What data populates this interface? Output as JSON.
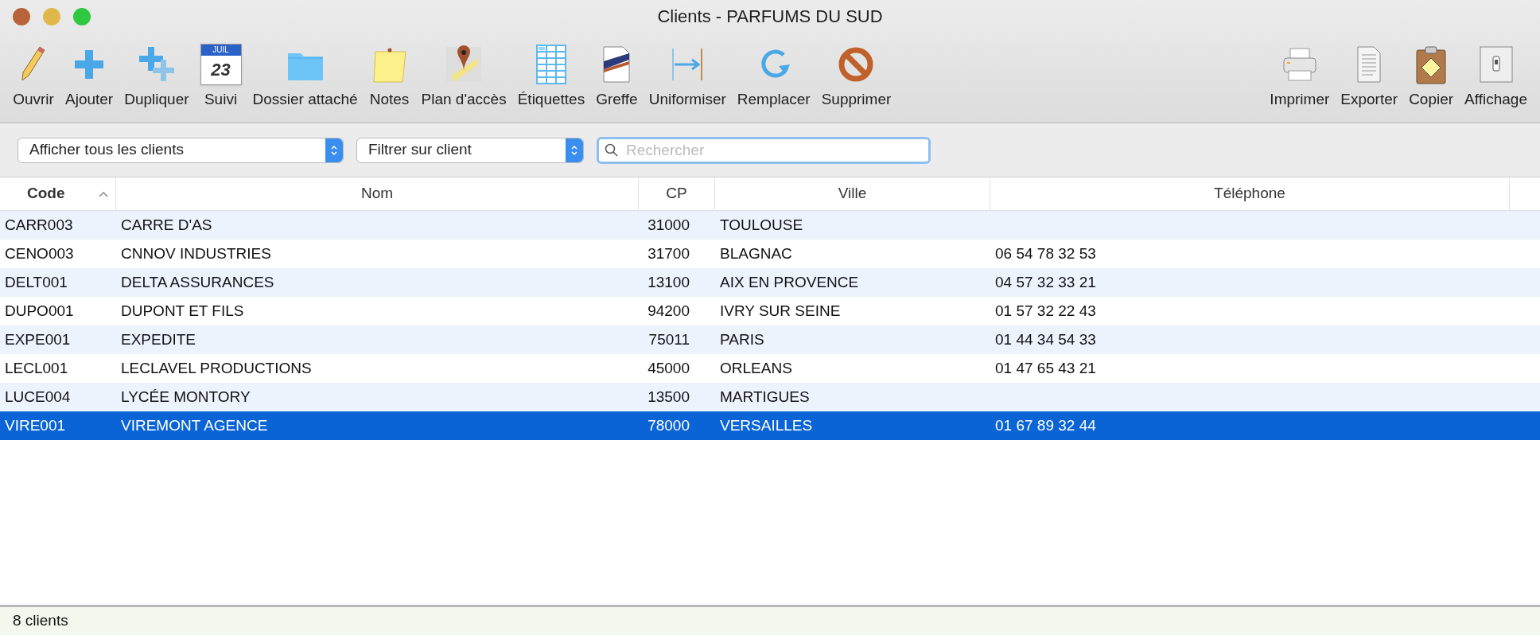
{
  "window": {
    "title": "Clients - PARFUMS DU SUD"
  },
  "toolbar": {
    "left": [
      {
        "label": "Ouvrir"
      },
      {
        "label": "Ajouter"
      },
      {
        "label": "Dupliquer"
      },
      {
        "label": "Suivi",
        "icon_text": "JUIL",
        "icon_day": "23"
      },
      {
        "label": "Dossier attaché"
      },
      {
        "label": "Notes"
      },
      {
        "label": "Plan d'accès"
      },
      {
        "label": "Étiquettes"
      },
      {
        "label": "Greffe"
      },
      {
        "label": "Uniformiser"
      },
      {
        "label": "Remplacer"
      },
      {
        "label": "Supprimer"
      }
    ],
    "right": [
      {
        "label": "Imprimer"
      },
      {
        "label": "Exporter"
      },
      {
        "label": "Copier"
      },
      {
        "label": "Affichage"
      }
    ]
  },
  "filters": {
    "show": "Afficher tous les clients",
    "filter": "Filtrer sur client",
    "search": {
      "placeholder": "Rechercher"
    }
  },
  "table": {
    "columns": [
      {
        "label": "Code",
        "sorted": true
      },
      {
        "label": "Nom",
        "sorted": false
      },
      {
        "label": "CP",
        "sorted": false
      },
      {
        "label": "Ville",
        "sorted": false
      },
      {
        "label": "Téléphone",
        "sorted": false
      }
    ],
    "rows": [
      {
        "code": "CARR003",
        "nom": "CARRE D'AS",
        "cp": "31000",
        "ville": "TOULOUSE",
        "telephone": "",
        "selected": false
      },
      {
        "code": "CENO003",
        "nom": "CNNOV INDUSTRIES",
        "cp": "31700",
        "ville": "BLAGNAC",
        "telephone": "06 54 78 32 53",
        "selected": false
      },
      {
        "code": "DELT001",
        "nom": "DELTA ASSURANCES",
        "cp": "13100",
        "ville": "AIX EN PROVENCE",
        "telephone": "04 57 32 33 21",
        "selected": false
      },
      {
        "code": "DUPO001",
        "nom": "DUPONT ET FILS",
        "cp": "94200",
        "ville": "IVRY SUR SEINE",
        "telephone": "01 57 32 22 43",
        "selected": false
      },
      {
        "code": "EXPE001",
        "nom": "EXPEDITE",
        "cp": "75011",
        "ville": "PARIS",
        "telephone": "01 44 34 54 33",
        "selected": false
      },
      {
        "code": "LECL001",
        "nom": "LECLAVEL PRODUCTIONS",
        "cp": "45000",
        "ville": "ORLEANS",
        "telephone": "01 47 65 43 21",
        "selected": false
      },
      {
        "code": "LUCE004",
        "nom": "LYCÉE MONTORY",
        "cp": "13500",
        "ville": "MARTIGUES",
        "telephone": "",
        "selected": false
      },
      {
        "code": "VIRE001",
        "nom": "VIREMONT AGENCE",
        "cp": "78000",
        "ville": "VERSAILLES",
        "telephone": "01 67 89 32 44",
        "selected": true
      }
    ]
  },
  "status_bar": "8 clients"
}
